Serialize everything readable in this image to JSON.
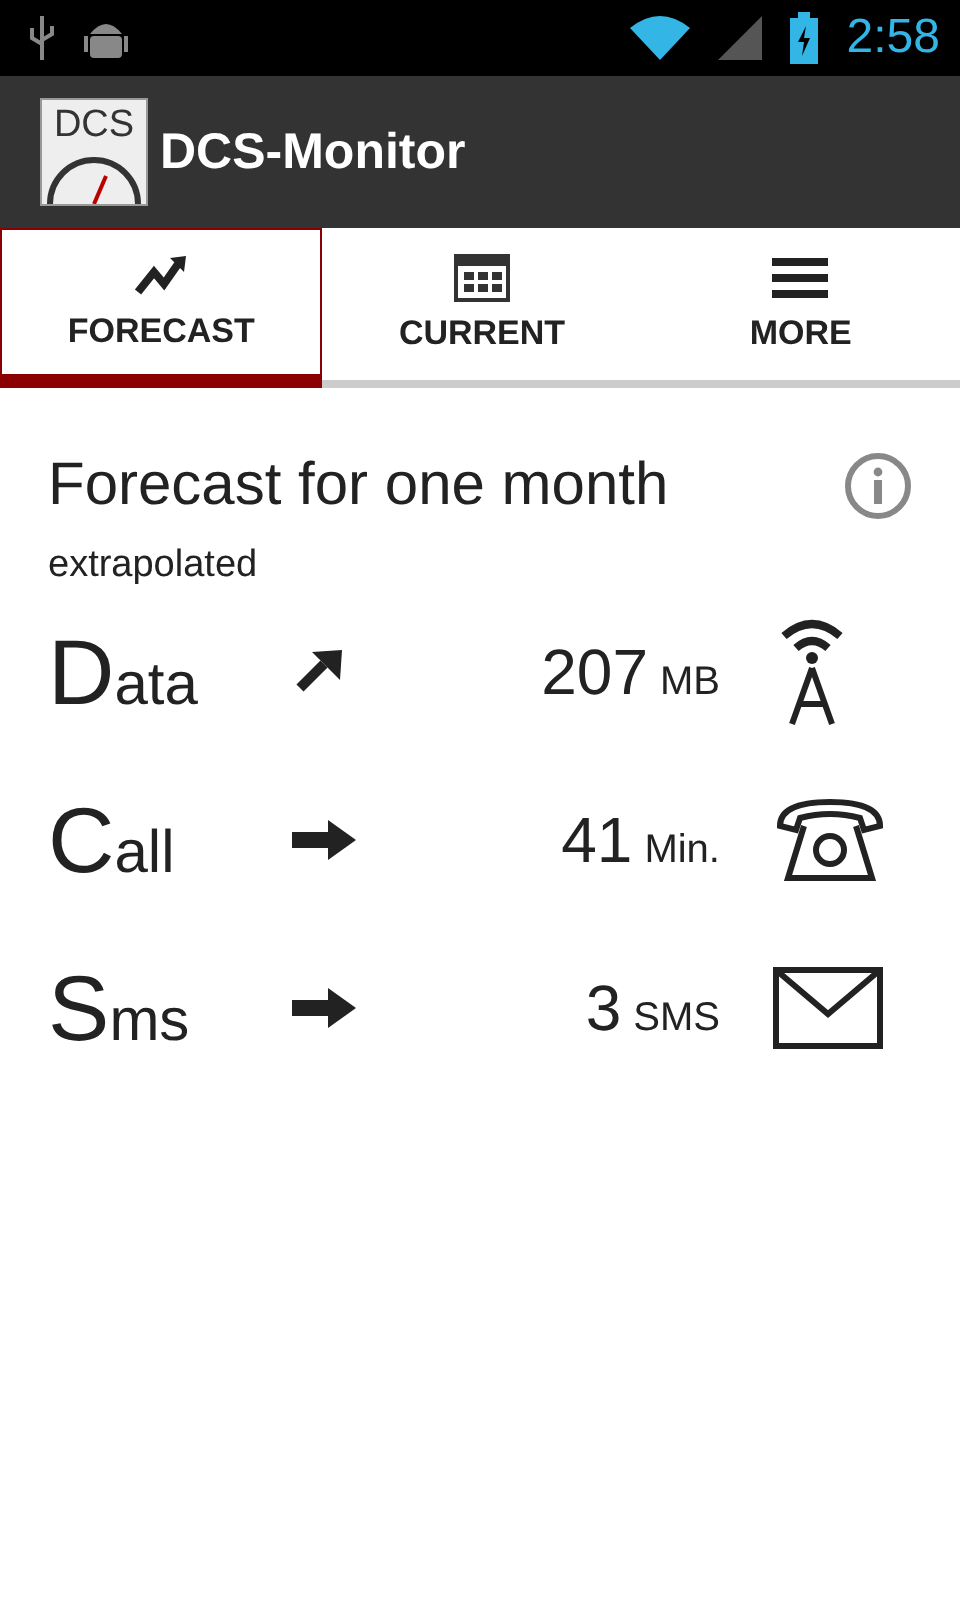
{
  "status_bar": {
    "time": "2:58"
  },
  "app_bar": {
    "logo_text": "DCS",
    "title": "DCS-Monitor"
  },
  "tabs": [
    {
      "label": "FORECAST",
      "selected": true
    },
    {
      "label": "CURRENT",
      "selected": false
    },
    {
      "label": "MORE",
      "selected": false
    }
  ],
  "heading": "Forecast for one month",
  "subtitle": "extrapolated",
  "rows": [
    {
      "label": "Data",
      "kind": "rising",
      "value": "207",
      "unit": "MB"
    },
    {
      "label": "Call",
      "kind": "steady",
      "value": "41",
      "unit": "Min."
    },
    {
      "label": "Sms",
      "kind": "steady",
      "value": "3",
      "unit": "SMS"
    }
  ]
}
